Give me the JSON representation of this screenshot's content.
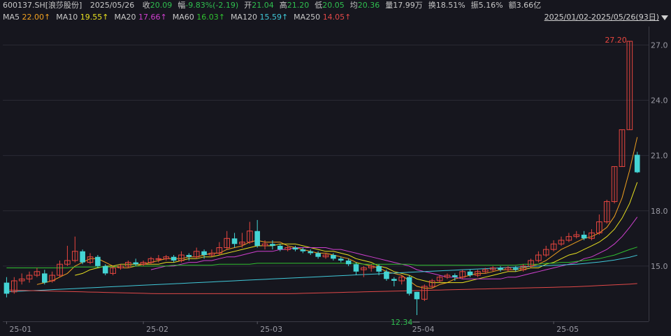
{
  "header": {
    "symbol": "600137.SH[浪莎股份]",
    "date": "2025/05/26",
    "stats": [
      {
        "label": "收",
        "value": "20.09",
        "tone": "down"
      },
      {
        "label": "幅",
        "value": "-9.83%(-2.19)",
        "tone": "down"
      },
      {
        "label": "开",
        "value": "21.04",
        "tone": "down"
      },
      {
        "label": "高",
        "value": "21.20",
        "tone": "down"
      },
      {
        "label": "低",
        "value": "20.05",
        "tone": "down"
      },
      {
        "label": "均",
        "value": "20.36",
        "tone": "down"
      },
      {
        "label": "量",
        "value": "17.99万",
        "tone": "neutral"
      },
      {
        "label": "换",
        "value": "18.51%",
        "tone": "neutral"
      },
      {
        "label": "振",
        "value": "5.16%",
        "tone": "neutral"
      },
      {
        "label": "额",
        "value": "3.66亿",
        "tone": "neutral"
      }
    ],
    "range": "2025/01/02-2025/05/26(93日)"
  },
  "ma_legend": [
    {
      "label": "MA5",
      "value": "22.00↑",
      "color": "#f0a020"
    },
    {
      "label": "MA10",
      "value": "19.55↑",
      "color": "#e8e020"
    },
    {
      "label": "MA20",
      "value": "17.66↑",
      "color": "#d040d0"
    },
    {
      "label": "MA60",
      "value": "16.03↑",
      "color": "#30c030"
    },
    {
      "label": "MA120",
      "value": "15.59↑",
      "color": "#40c8d8"
    },
    {
      "label": "MA250",
      "value": "14.05↑",
      "color": "#e04848"
    }
  ],
  "colors": {
    "up": "#e8463f",
    "down": "#2fbf4f",
    "bar_down": "#44d4d4",
    "grid": "#2a2a34"
  },
  "chart_data": {
    "type": "candlestick",
    "ylim": [
      12.0,
      28.0
    ],
    "y_ticks": [
      "15.0",
      "18.0",
      "21.0",
      "24.0",
      "27.0"
    ],
    "x_ticks": [
      {
        "label": "25-01",
        "index": 0
      },
      {
        "label": "25-02",
        "index": 18
      },
      {
        "label": "25-03",
        "index": 33
      },
      {
        "label": "25-04",
        "index": 53
      },
      {
        "label": "25-05",
        "index": 72
      }
    ],
    "annotations": [
      {
        "text": "27.20",
        "index": 82,
        "price": 27.2,
        "kind": "high"
      },
      {
        "text": "12.34",
        "index": 54,
        "price": 12.34,
        "kind": "low"
      }
    ],
    "candles": [
      [
        14.1,
        13.5,
        14.4,
        13.3
      ],
      [
        13.6,
        14.2,
        14.4,
        13.5
      ],
      [
        14.2,
        14.3,
        14.6,
        14.0
      ],
      [
        14.3,
        14.5,
        14.7,
        14.1
      ],
      [
        14.5,
        14.7,
        14.9,
        14.4
      ],
      [
        14.6,
        14.1,
        14.8,
        14.0
      ],
      [
        14.2,
        14.5,
        14.7,
        14.1
      ],
      [
        14.5,
        15.1,
        15.3,
        14.4
      ],
      [
        15.1,
        15.3,
        16.1,
        15.0
      ],
      [
        15.3,
        15.8,
        16.6,
        15.2
      ],
      [
        15.8,
        15.2,
        15.9,
        15.1
      ],
      [
        15.2,
        15.5,
        15.7,
        15.1
      ],
      [
        15.5,
        15.0,
        15.6,
        14.9
      ],
      [
        15.0,
        14.6,
        15.1,
        14.5
      ],
      [
        14.6,
        14.9,
        15.0,
        14.5
      ],
      [
        14.9,
        15.0,
        15.1,
        14.8
      ],
      [
        15.0,
        15.2,
        15.3,
        14.9
      ],
      [
        15.2,
        15.1,
        15.4,
        15.0
      ],
      [
        15.1,
        15.2,
        15.3,
        15.0
      ],
      [
        15.2,
        15.4,
        15.5,
        15.1
      ],
      [
        15.4,
        15.4,
        15.6,
        15.2
      ],
      [
        15.4,
        15.5,
        15.6,
        15.3
      ],
      [
        15.5,
        15.3,
        15.6,
        15.2
      ],
      [
        15.3,
        15.6,
        15.8,
        15.2
      ],
      [
        15.6,
        15.5,
        15.7,
        15.3
      ],
      [
        15.5,
        15.8,
        16.0,
        15.4
      ],
      [
        15.8,
        15.6,
        15.9,
        15.4
      ],
      [
        15.6,
        15.7,
        15.9,
        15.5
      ],
      [
        15.7,
        16.0,
        16.3,
        15.6
      ],
      [
        16.0,
        16.5,
        16.9,
        15.9
      ],
      [
        16.5,
        16.2,
        16.8,
        16.0
      ],
      [
        16.2,
        16.3,
        16.8,
        16.0
      ],
      [
        16.3,
        16.9,
        17.4,
        16.2
      ],
      [
        16.9,
        16.1,
        17.5,
        16.0
      ],
      [
        16.1,
        16.2,
        16.4,
        15.9
      ],
      [
        16.2,
        16.1,
        16.4,
        15.9
      ],
      [
        16.1,
        15.9,
        16.2,
        15.8
      ],
      [
        15.9,
        16.0,
        16.1,
        15.8
      ],
      [
        16.0,
        15.9,
        16.1,
        15.8
      ],
      [
        15.9,
        15.8,
        16.0,
        15.7
      ],
      [
        15.8,
        15.7,
        15.9,
        15.6
      ],
      [
        15.7,
        15.5,
        15.8,
        15.4
      ],
      [
        15.5,
        15.6,
        15.7,
        15.4
      ],
      [
        15.6,
        15.4,
        15.7,
        15.3
      ],
      [
        15.4,
        15.3,
        15.5,
        15.2
      ],
      [
        15.3,
        15.1,
        15.4,
        15.0
      ],
      [
        15.1,
        14.7,
        15.2,
        14.5
      ],
      [
        14.8,
        14.9,
        15.0,
        14.4
      ],
      [
        14.9,
        15.0,
        15.1,
        14.7
      ],
      [
        15.0,
        14.7,
        15.1,
        14.5
      ],
      [
        14.7,
        14.3,
        14.8,
        14.2
      ],
      [
        14.3,
        14.2,
        14.4,
        13.9
      ],
      [
        14.2,
        14.4,
        14.5,
        14.0
      ],
      [
        14.4,
        13.5,
        14.5,
        13.4
      ],
      [
        13.6,
        13.2,
        13.6,
        12.34
      ],
      [
        13.2,
        13.9,
        14.0,
        13.1
      ],
      [
        13.9,
        14.2,
        14.3,
        13.8
      ],
      [
        14.2,
        14.4,
        14.5,
        14.1
      ],
      [
        14.4,
        14.5,
        14.6,
        14.3
      ],
      [
        14.5,
        14.4,
        14.6,
        14.2
      ],
      [
        14.4,
        14.7,
        14.8,
        14.3
      ],
      [
        14.7,
        14.5,
        14.8,
        14.4
      ],
      [
        14.5,
        14.7,
        14.8,
        14.4
      ],
      [
        14.7,
        14.8,
        14.9,
        14.6
      ],
      [
        14.8,
        14.9,
        15.0,
        14.7
      ],
      [
        14.9,
        14.8,
        15.0,
        14.7
      ],
      [
        14.8,
        14.9,
        15.0,
        14.7
      ],
      [
        14.9,
        14.8,
        15.0,
        14.7
      ],
      [
        14.8,
        15.0,
        15.1,
        14.7
      ],
      [
        15.0,
        15.3,
        15.4,
        14.9
      ],
      [
        15.3,
        15.6,
        15.8,
        15.2
      ],
      [
        15.6,
        15.9,
        16.1,
        15.5
      ],
      [
        15.9,
        16.2,
        16.4,
        15.8
      ],
      [
        16.2,
        16.4,
        16.6,
        16.1
      ],
      [
        16.4,
        16.6,
        16.8,
        16.3
      ],
      [
        16.6,
        16.7,
        16.9,
        16.5
      ],
      [
        16.7,
        16.5,
        16.9,
        16.4
      ],
      [
        16.5,
        16.8,
        17.0,
        16.4
      ],
      [
        16.8,
        17.4,
        17.8,
        16.7
      ],
      [
        17.4,
        18.5,
        18.6,
        17.3
      ],
      [
        18.5,
        20.4,
        20.4,
        18.4
      ],
      [
        20.4,
        22.4,
        22.4,
        20.4
      ],
      [
        22.4,
        27.2,
        27.2,
        22.4
      ],
      [
        21.04,
        20.09,
        21.2,
        20.05
      ]
    ],
    "ma": [
      {
        "name": "MA5",
        "values": [
          null,
          null,
          null,
          null,
          14.0,
          14.1,
          14.2,
          14.4,
          14.6,
          15.0,
          15.2,
          15.4,
          15.4,
          15.2,
          15.0,
          14.9,
          14.9,
          15.0,
          15.1,
          15.2,
          15.3,
          15.4,
          15.4,
          15.4,
          15.5,
          15.5,
          15.6,
          15.7,
          15.7,
          15.9,
          16.0,
          16.1,
          16.3,
          16.4,
          16.3,
          16.3,
          16.3,
          16.1,
          16.0,
          15.9,
          15.8,
          15.7,
          15.7,
          15.6,
          15.5,
          15.4,
          15.2,
          15.1,
          15.0,
          14.9,
          14.7,
          14.6,
          14.5,
          14.2,
          13.9,
          13.8,
          13.8,
          14.0,
          14.1,
          14.3,
          14.4,
          14.5,
          14.6,
          14.6,
          14.7,
          14.8,
          14.8,
          14.8,
          14.9,
          15.0,
          15.1,
          15.3,
          15.6,
          15.9,
          16.1,
          16.3,
          16.5,
          16.6,
          16.8,
          17.1,
          17.7,
          18.7,
          20.2,
          22.0
        ]
      },
      {
        "name": "MA10",
        "values": [
          null,
          null,
          null,
          null,
          null,
          null,
          null,
          null,
          null,
          14.5,
          14.6,
          14.8,
          14.9,
          15.0,
          15.0,
          15.1,
          15.1,
          15.1,
          15.1,
          15.1,
          15.1,
          15.2,
          15.2,
          15.3,
          15.4,
          15.4,
          15.5,
          15.5,
          15.6,
          15.7,
          15.8,
          15.9,
          16.0,
          16.1,
          16.1,
          16.1,
          16.2,
          16.2,
          16.2,
          16.1,
          16.0,
          15.9,
          15.8,
          15.8,
          15.7,
          15.6,
          15.4,
          15.3,
          15.2,
          15.0,
          14.9,
          14.7,
          14.6,
          14.5,
          14.3,
          14.2,
          14.1,
          14.1,
          14.1,
          14.1,
          14.1,
          14.2,
          14.3,
          14.4,
          14.5,
          14.6,
          14.7,
          14.7,
          14.8,
          14.9,
          14.9,
          15.1,
          15.2,
          15.4,
          15.6,
          15.7,
          15.9,
          16.1,
          16.3,
          16.6,
          17.0,
          17.6,
          18.4,
          19.55
        ]
      },
      {
        "name": "MA20",
        "values": [
          null,
          null,
          null,
          null,
          null,
          null,
          null,
          null,
          null,
          null,
          null,
          null,
          null,
          null,
          null,
          null,
          null,
          null,
          null,
          14.8,
          14.9,
          15.0,
          15.0,
          15.1,
          15.2,
          15.2,
          15.3,
          15.3,
          15.4,
          15.5,
          15.5,
          15.6,
          15.7,
          15.8,
          15.8,
          15.8,
          15.9,
          15.9,
          16.0,
          16.0,
          16.0,
          16.0,
          16.0,
          15.9,
          15.9,
          15.8,
          15.7,
          15.6,
          15.5,
          15.4,
          15.3,
          15.2,
          15.1,
          15.0,
          14.8,
          14.7,
          14.6,
          14.5,
          14.4,
          14.4,
          14.3,
          14.3,
          14.3,
          14.3,
          14.3,
          14.3,
          14.4,
          14.4,
          14.5,
          14.6,
          14.7,
          14.8,
          14.9,
          15.0,
          15.1,
          15.2,
          15.4,
          15.5,
          15.7,
          15.9,
          16.2,
          16.6,
          17.1,
          17.66
        ]
      },
      {
        "name": "MA60",
        "values": [
          14.9,
          14.9,
          14.9,
          14.9,
          14.9,
          14.9,
          14.9,
          14.9,
          14.9,
          14.95,
          14.95,
          14.95,
          14.95,
          14.95,
          14.95,
          15.0,
          15.0,
          15.0,
          15.0,
          15.0,
          15.0,
          15.0,
          15.05,
          15.05,
          15.05,
          15.05,
          15.05,
          15.05,
          15.1,
          15.1,
          15.1,
          15.1,
          15.1,
          15.15,
          15.15,
          15.15,
          15.15,
          15.15,
          15.15,
          15.15,
          15.15,
          15.15,
          15.15,
          15.15,
          15.15,
          15.15,
          15.15,
          15.1,
          15.1,
          15.1,
          15.1,
          15.1,
          15.1,
          15.1,
          15.05,
          15.05,
          15.05,
          15.05,
          15.05,
          15.05,
          15.05,
          15.05,
          15.05,
          15.05,
          15.05,
          15.05,
          15.05,
          15.05,
          15.1,
          15.1,
          15.1,
          15.15,
          15.15,
          15.2,
          15.2,
          15.25,
          15.3,
          15.35,
          15.4,
          15.5,
          15.6,
          15.75,
          15.9,
          16.03
        ]
      },
      {
        "name": "MA120",
        "values": [
          13.6,
          13.62,
          13.64,
          13.66,
          13.68,
          13.7,
          13.72,
          13.74,
          13.76,
          13.78,
          13.8,
          13.82,
          13.84,
          13.86,
          13.88,
          13.9,
          13.92,
          13.94,
          13.96,
          13.98,
          14.0,
          14.02,
          14.04,
          14.06,
          14.08,
          14.1,
          14.12,
          14.14,
          14.16,
          14.18,
          14.2,
          14.22,
          14.24,
          14.26,
          14.28,
          14.3,
          14.32,
          14.34,
          14.36,
          14.38,
          14.4,
          14.42,
          14.44,
          14.46,
          14.48,
          14.5,
          14.52,
          14.54,
          14.56,
          14.58,
          14.6,
          14.62,
          14.64,
          14.66,
          14.68,
          14.7,
          14.72,
          14.74,
          14.76,
          14.78,
          14.8,
          14.82,
          14.84,
          14.86,
          14.88,
          14.9,
          14.92,
          14.94,
          14.96,
          14.98,
          15.0,
          15.02,
          15.04,
          15.06,
          15.08,
          15.1,
          15.14,
          15.18,
          15.22,
          15.27,
          15.33,
          15.4,
          15.48,
          15.59
        ]
      },
      {
        "name": "MA250",
        "values": [
          13.7,
          13.69,
          13.68,
          13.67,
          13.66,
          13.65,
          13.64,
          13.63,
          13.62,
          13.61,
          13.6,
          13.59,
          13.58,
          13.57,
          13.56,
          13.55,
          13.54,
          13.53,
          13.52,
          13.51,
          13.5,
          13.5,
          13.5,
          13.5,
          13.5,
          13.5,
          13.5,
          13.5,
          13.5,
          13.5,
          13.5,
          13.5,
          13.5,
          13.5,
          13.5,
          13.5,
          13.5,
          13.5,
          13.51,
          13.52,
          13.53,
          13.54,
          13.55,
          13.56,
          13.57,
          13.58,
          13.59,
          13.6,
          13.61,
          13.62,
          13.63,
          13.64,
          13.65,
          13.66,
          13.67,
          13.68,
          13.69,
          13.7,
          13.71,
          13.72,
          13.73,
          13.74,
          13.75,
          13.76,
          13.77,
          13.78,
          13.79,
          13.8,
          13.81,
          13.82,
          13.83,
          13.84,
          13.85,
          13.86,
          13.87,
          13.88,
          13.9,
          13.92,
          13.94,
          13.96,
          13.98,
          14.0,
          14.02,
          14.05
        ]
      }
    ]
  }
}
